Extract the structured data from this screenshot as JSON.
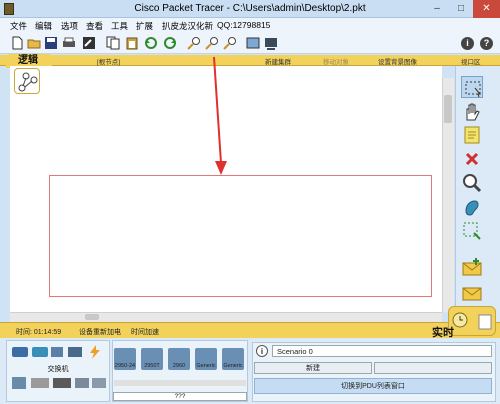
{
  "window": {
    "title": "Cisco Packet Tracer - C:\\Users\\admin\\Desktop\\2.pkt",
    "min": "–",
    "max": "□",
    "close": "✕"
  },
  "menu": [
    "文件",
    "编辑",
    "选项",
    "查看",
    "工具",
    "扩展",
    "扒皮龙汉化新",
    "QQ:12798815"
  ],
  "toolbar": {
    "icons": [
      "new-file-icon",
      "open-folder-icon",
      "save-icon",
      "print-icon",
      "activity-wizard-icon",
      "copy-icon",
      "paste-icon",
      "undo-icon",
      "redo-icon",
      "zoom-in-icon",
      "zoom-reset-icon",
      "zoom-out-icon",
      "drawing-palette-icon",
      "custom-device-icon"
    ],
    "help": "i",
    "help2": "?"
  },
  "workspace": {
    "logical_tab": "逻辑",
    "root_label": "[根节点]",
    "new_cluster": "新建集群",
    "move_object": "移动对象",
    "set_background": "设置背景图像",
    "viewport": "视口区"
  },
  "realtime": {
    "time": "时间: 01:14:59",
    "power_cycle": "设备重新加电",
    "fast_forward": "时间加速",
    "mode": "实时"
  },
  "devices": {
    "category_label": "交换机",
    "items": [
      "2950-24",
      "2950T",
      "2960",
      "Generic",
      "Generic"
    ],
    "selected": "???"
  },
  "scenario": {
    "info": "i",
    "name": "Scenario 0",
    "new_label": "新建",
    "toggle_pdu": "切换到PDU列表窗口"
  },
  "colors": {
    "accent_yellow": "#f2d25b",
    "annotation_red": "#e03030",
    "palette_bg": "#dce9f6"
  }
}
